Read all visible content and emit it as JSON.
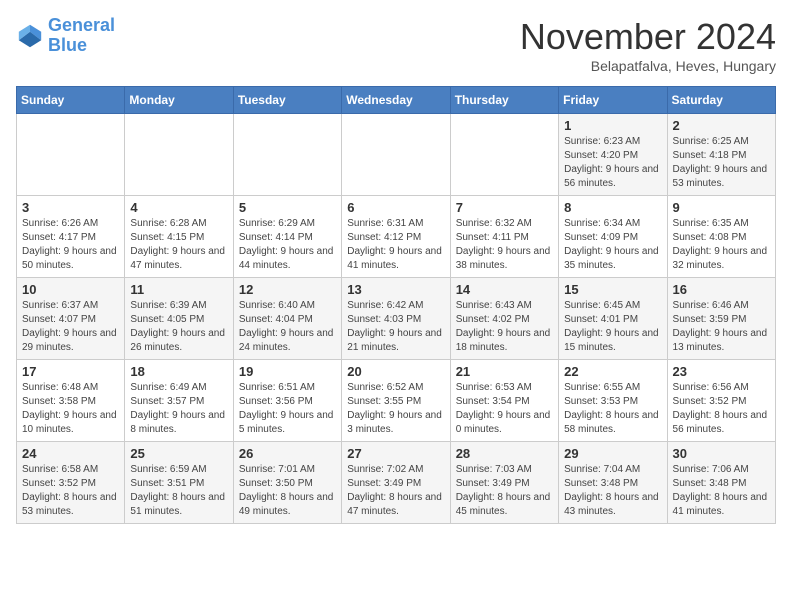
{
  "logo": {
    "text1": "General",
    "text2": "Blue"
  },
  "title": "November 2024",
  "subtitle": "Belapatfalva, Heves, Hungary",
  "days_header": [
    "Sunday",
    "Monday",
    "Tuesday",
    "Wednesday",
    "Thursday",
    "Friday",
    "Saturday"
  ],
  "weeks": [
    [
      {
        "day": "",
        "info": ""
      },
      {
        "day": "",
        "info": ""
      },
      {
        "day": "",
        "info": ""
      },
      {
        "day": "",
        "info": ""
      },
      {
        "day": "",
        "info": ""
      },
      {
        "day": "1",
        "info": "Sunrise: 6:23 AM\nSunset: 4:20 PM\nDaylight: 9 hours and 56 minutes."
      },
      {
        "day": "2",
        "info": "Sunrise: 6:25 AM\nSunset: 4:18 PM\nDaylight: 9 hours and 53 minutes."
      }
    ],
    [
      {
        "day": "3",
        "info": "Sunrise: 6:26 AM\nSunset: 4:17 PM\nDaylight: 9 hours and 50 minutes."
      },
      {
        "day": "4",
        "info": "Sunrise: 6:28 AM\nSunset: 4:15 PM\nDaylight: 9 hours and 47 minutes."
      },
      {
        "day": "5",
        "info": "Sunrise: 6:29 AM\nSunset: 4:14 PM\nDaylight: 9 hours and 44 minutes."
      },
      {
        "day": "6",
        "info": "Sunrise: 6:31 AM\nSunset: 4:12 PM\nDaylight: 9 hours and 41 minutes."
      },
      {
        "day": "7",
        "info": "Sunrise: 6:32 AM\nSunset: 4:11 PM\nDaylight: 9 hours and 38 minutes."
      },
      {
        "day": "8",
        "info": "Sunrise: 6:34 AM\nSunset: 4:09 PM\nDaylight: 9 hours and 35 minutes."
      },
      {
        "day": "9",
        "info": "Sunrise: 6:35 AM\nSunset: 4:08 PM\nDaylight: 9 hours and 32 minutes."
      }
    ],
    [
      {
        "day": "10",
        "info": "Sunrise: 6:37 AM\nSunset: 4:07 PM\nDaylight: 9 hours and 29 minutes."
      },
      {
        "day": "11",
        "info": "Sunrise: 6:39 AM\nSunset: 4:05 PM\nDaylight: 9 hours and 26 minutes."
      },
      {
        "day": "12",
        "info": "Sunrise: 6:40 AM\nSunset: 4:04 PM\nDaylight: 9 hours and 24 minutes."
      },
      {
        "day": "13",
        "info": "Sunrise: 6:42 AM\nSunset: 4:03 PM\nDaylight: 9 hours and 21 minutes."
      },
      {
        "day": "14",
        "info": "Sunrise: 6:43 AM\nSunset: 4:02 PM\nDaylight: 9 hours and 18 minutes."
      },
      {
        "day": "15",
        "info": "Sunrise: 6:45 AM\nSunset: 4:01 PM\nDaylight: 9 hours and 15 minutes."
      },
      {
        "day": "16",
        "info": "Sunrise: 6:46 AM\nSunset: 3:59 PM\nDaylight: 9 hours and 13 minutes."
      }
    ],
    [
      {
        "day": "17",
        "info": "Sunrise: 6:48 AM\nSunset: 3:58 PM\nDaylight: 9 hours and 10 minutes."
      },
      {
        "day": "18",
        "info": "Sunrise: 6:49 AM\nSunset: 3:57 PM\nDaylight: 9 hours and 8 minutes."
      },
      {
        "day": "19",
        "info": "Sunrise: 6:51 AM\nSunset: 3:56 PM\nDaylight: 9 hours and 5 minutes."
      },
      {
        "day": "20",
        "info": "Sunrise: 6:52 AM\nSunset: 3:55 PM\nDaylight: 9 hours and 3 minutes."
      },
      {
        "day": "21",
        "info": "Sunrise: 6:53 AM\nSunset: 3:54 PM\nDaylight: 9 hours and 0 minutes."
      },
      {
        "day": "22",
        "info": "Sunrise: 6:55 AM\nSunset: 3:53 PM\nDaylight: 8 hours and 58 minutes."
      },
      {
        "day": "23",
        "info": "Sunrise: 6:56 AM\nSunset: 3:52 PM\nDaylight: 8 hours and 56 minutes."
      }
    ],
    [
      {
        "day": "24",
        "info": "Sunrise: 6:58 AM\nSunset: 3:52 PM\nDaylight: 8 hours and 53 minutes."
      },
      {
        "day": "25",
        "info": "Sunrise: 6:59 AM\nSunset: 3:51 PM\nDaylight: 8 hours and 51 minutes."
      },
      {
        "day": "26",
        "info": "Sunrise: 7:01 AM\nSunset: 3:50 PM\nDaylight: 8 hours and 49 minutes."
      },
      {
        "day": "27",
        "info": "Sunrise: 7:02 AM\nSunset: 3:49 PM\nDaylight: 8 hours and 47 minutes."
      },
      {
        "day": "28",
        "info": "Sunrise: 7:03 AM\nSunset: 3:49 PM\nDaylight: 8 hours and 45 minutes."
      },
      {
        "day": "29",
        "info": "Sunrise: 7:04 AM\nSunset: 3:48 PM\nDaylight: 8 hours and 43 minutes."
      },
      {
        "day": "30",
        "info": "Sunrise: 7:06 AM\nSunset: 3:48 PM\nDaylight: 8 hours and 41 minutes."
      }
    ]
  ]
}
